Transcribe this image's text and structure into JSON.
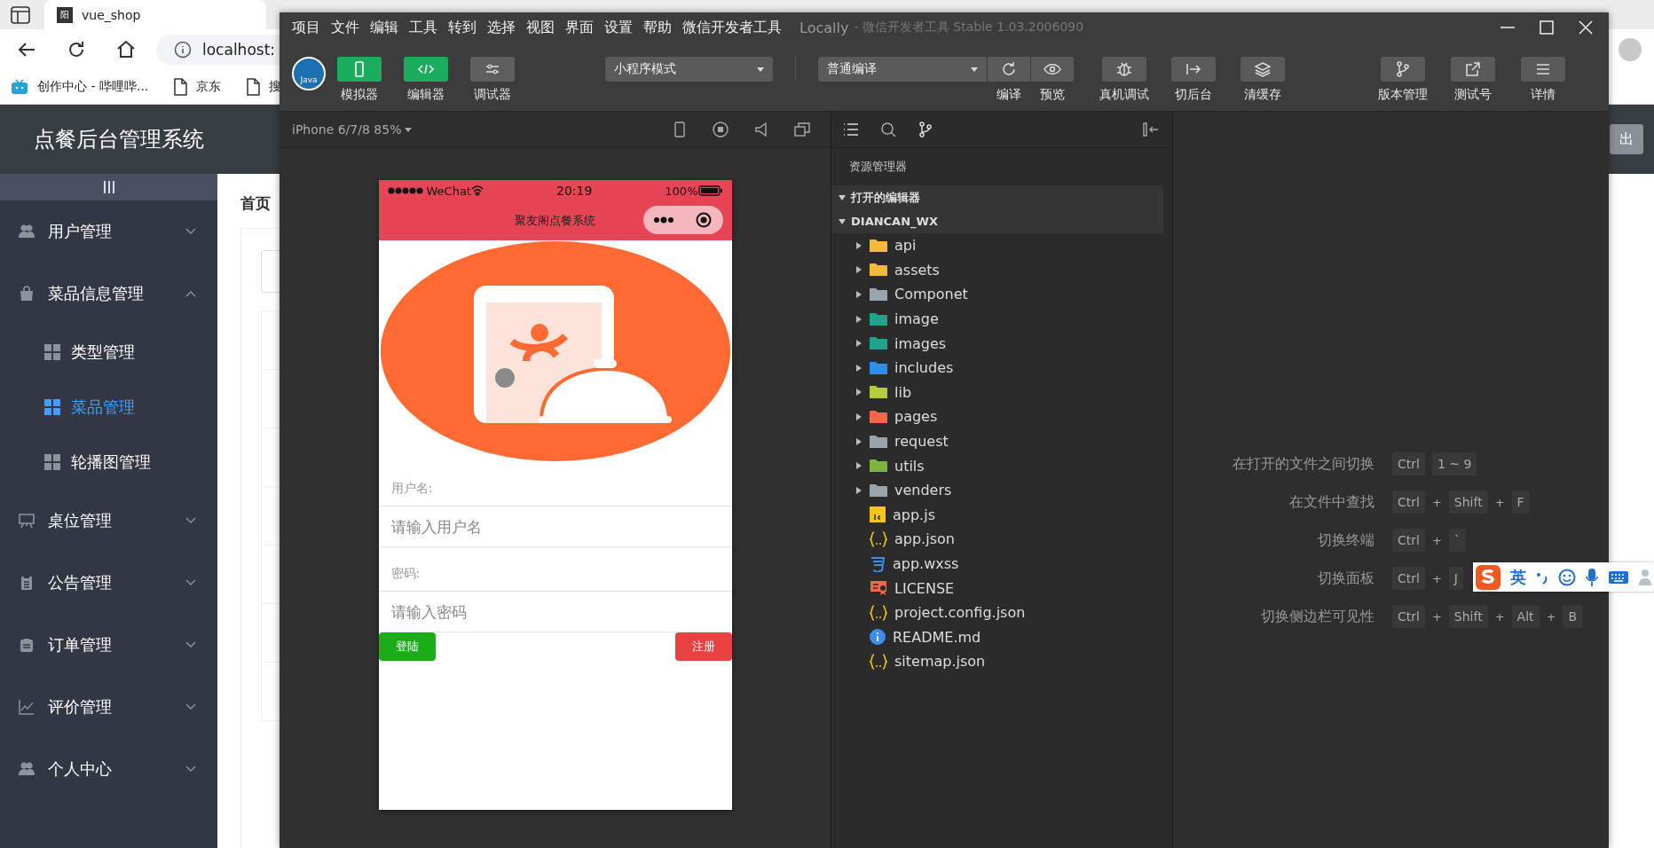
{
  "browser": {
    "tab": {
      "favicon": "阳",
      "title": "vue_shop"
    },
    "address": "localhost:",
    "bookmarks": [
      "创作中心 - 哔哩哔...",
      "京东",
      "搜"
    ]
  },
  "admin": {
    "title": "点餐后台管理系统",
    "logout": "出",
    "breadcrumb": "首页",
    "sidebar": [
      {
        "label": "用户管理",
        "expanded": false
      },
      {
        "label": "菜品信息管理",
        "expanded": true,
        "children": [
          {
            "label": "类型管理",
            "selected": false
          },
          {
            "label": "菜品管理",
            "selected": true
          },
          {
            "label": "轮播图管理",
            "selected": false
          }
        ]
      },
      {
        "label": "桌位管理",
        "expanded": false
      },
      {
        "label": "公告管理",
        "expanded": false
      },
      {
        "label": "订单管理",
        "expanded": false
      },
      {
        "label": "评价管理",
        "expanded": false
      },
      {
        "label": "个人中心",
        "expanded": false
      }
    ]
  },
  "devtools": {
    "menu": [
      "项目",
      "文件",
      "编辑",
      "工具",
      "转到",
      "选择",
      "视图",
      "界面",
      "设置",
      "帮助",
      "微信开发者工具"
    ],
    "title": "Locally",
    "subtitle": "- 微信开发者工具 Stable 1.03.2006090",
    "toolbar": {
      "avatar_text": "Java",
      "toggles": [
        {
          "label": "模拟器",
          "on": true
        },
        {
          "label": "编辑器",
          "on": true
        },
        {
          "label": "调试器",
          "on": false
        }
      ],
      "mode": "小程序模式",
      "compile": "普通编译",
      "compile_actions": [
        "编译",
        "预览"
      ],
      "actions": [
        "真机调试",
        "切后台",
        "清缓存"
      ],
      "right_actions": [
        "版本管理",
        "测试号",
        "详情"
      ]
    },
    "simulator": {
      "device": "iPhone 6/7/8 85%",
      "carrier": "WeChat",
      "time": "20:19",
      "battery": "100%",
      "nav_title": "聚友阁点餐系统",
      "form": [
        {
          "label": "用户名:",
          "placeholder": "请输入用户名"
        },
        {
          "label": "密码:",
          "placeholder": "请输入密码"
        }
      ],
      "login": "登陆",
      "register": "注册"
    },
    "explorer": {
      "title": "资源管理器",
      "sections": [
        {
          "label": "打开的编辑器",
          "expanded": true
        },
        {
          "label": "DIANCAN_WX",
          "expanded": true,
          "children": [
            {
              "name": "api",
              "kind": "folder",
              "color": "#f5b93b",
              "expanded": false
            },
            {
              "name": "assets",
              "kind": "folder",
              "color": "#f5b93b",
              "expanded": false
            },
            {
              "name": "Componet",
              "kind": "folder",
              "color": "#9aa4ad",
              "expanded": false
            },
            {
              "name": "image",
              "kind": "folder",
              "color": "#1fa38a",
              "expanded": false
            },
            {
              "name": "images",
              "kind": "folder",
              "color": "#1fa38a",
              "expanded": false
            },
            {
              "name": "includes",
              "kind": "folder",
              "color": "#2f8ee8",
              "expanded": false
            },
            {
              "name": "lib",
              "kind": "folder",
              "color": "#b5cc3f",
              "expanded": false
            },
            {
              "name": "pages",
              "kind": "folder",
              "color": "#f06b45",
              "expanded": false
            },
            {
              "name": "request",
              "kind": "folder",
              "color": "#9aa4ad",
              "expanded": false
            },
            {
              "name": "utils",
              "kind": "folder",
              "color": "#7cb342",
              "expanded": false
            },
            {
              "name": "venders",
              "kind": "folder",
              "color": "#9aa4ad",
              "expanded": false
            },
            {
              "name": "app.js",
              "kind": "js"
            },
            {
              "name": "app.json",
              "kind": "json"
            },
            {
              "name": "app.wxss",
              "kind": "css"
            },
            {
              "name": "LICENSE",
              "kind": "license"
            },
            {
              "name": "project.config.json",
              "kind": "json"
            },
            {
              "name": "README.md",
              "kind": "info"
            },
            {
              "name": "sitemap.json",
              "kind": "json"
            }
          ]
        }
      ]
    },
    "shortcuts": [
      {
        "label": "在打开的文件之间切换",
        "keys": [
          {
            "kind": "key",
            "text": "Ctrl"
          },
          {
            "kind": "key",
            "text": "1 ~ 9"
          }
        ]
      },
      {
        "label": "在文件中查找",
        "keys": [
          {
            "kind": "key",
            "text": "Ctrl"
          },
          {
            "kind": "plus",
            "text": "+"
          },
          {
            "kind": "key",
            "text": "Shift"
          },
          {
            "kind": "plus",
            "text": "+"
          },
          {
            "kind": "key",
            "text": "F"
          }
        ]
      },
      {
        "label": "切换终端",
        "keys": [
          {
            "kind": "key",
            "text": "Ctrl"
          },
          {
            "kind": "plus",
            "text": "+"
          },
          {
            "kind": "key",
            "text": "`"
          }
        ]
      },
      {
        "label": "切换面板",
        "keys": [
          {
            "kind": "key",
            "text": "Ctrl"
          },
          {
            "kind": "plus",
            "text": "+"
          },
          {
            "kind": "key",
            "text": "J"
          }
        ]
      },
      {
        "label": "切换侧边栏可见性",
        "keys": [
          {
            "kind": "key",
            "text": "Ctrl"
          },
          {
            "kind": "plus",
            "text": "+"
          },
          {
            "kind": "key",
            "text": "Shift"
          },
          {
            "kind": "plus",
            "text": "+"
          },
          {
            "kind": "key",
            "text": "Alt"
          },
          {
            "kind": "plus",
            "text": "+"
          },
          {
            "kind": "key",
            "text": "B"
          }
        ]
      }
    ]
  },
  "ime": {
    "mode": "英"
  }
}
